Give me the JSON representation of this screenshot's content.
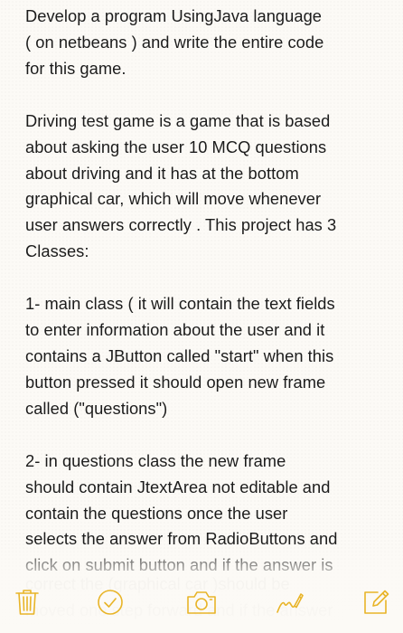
{
  "note": {
    "paragraphs": [
      "Develop a program UsingJava language\n( on netbeans ) and write the entire code\nfor this game.",
      "Driving test game is a game that is based\nabout asking the user 10 MCQ questions\nabout driving and it has at the bottom\ngraphical car, which will move whenever\nuser answers correctly . This project has 3\nClasses:",
      "1- main class ( it will contain the text fields\nto enter information about the user and it\ncontains a JButton called \"start\" when this\nbutton pressed it should open new frame\ncalled (\"questions\")",
      "2- in questions class the new frame\nshould contain  JtextArea not editable and\ncontain the questions  once the user\nselects the answer from RadioButtons and\nclick on submit button and if the answer is"
    ],
    "faded_continuation": "correct the (graphical car )should be\nmoved one step forward and if the answer"
  },
  "toolbar": {
    "accent": "#e8b428",
    "items": [
      {
        "icon": "trash-icon"
      },
      {
        "icon": "checklist-icon"
      },
      {
        "icon": "camera-icon"
      },
      {
        "icon": "sketch-icon"
      },
      {
        "icon": "compose-icon"
      }
    ]
  }
}
